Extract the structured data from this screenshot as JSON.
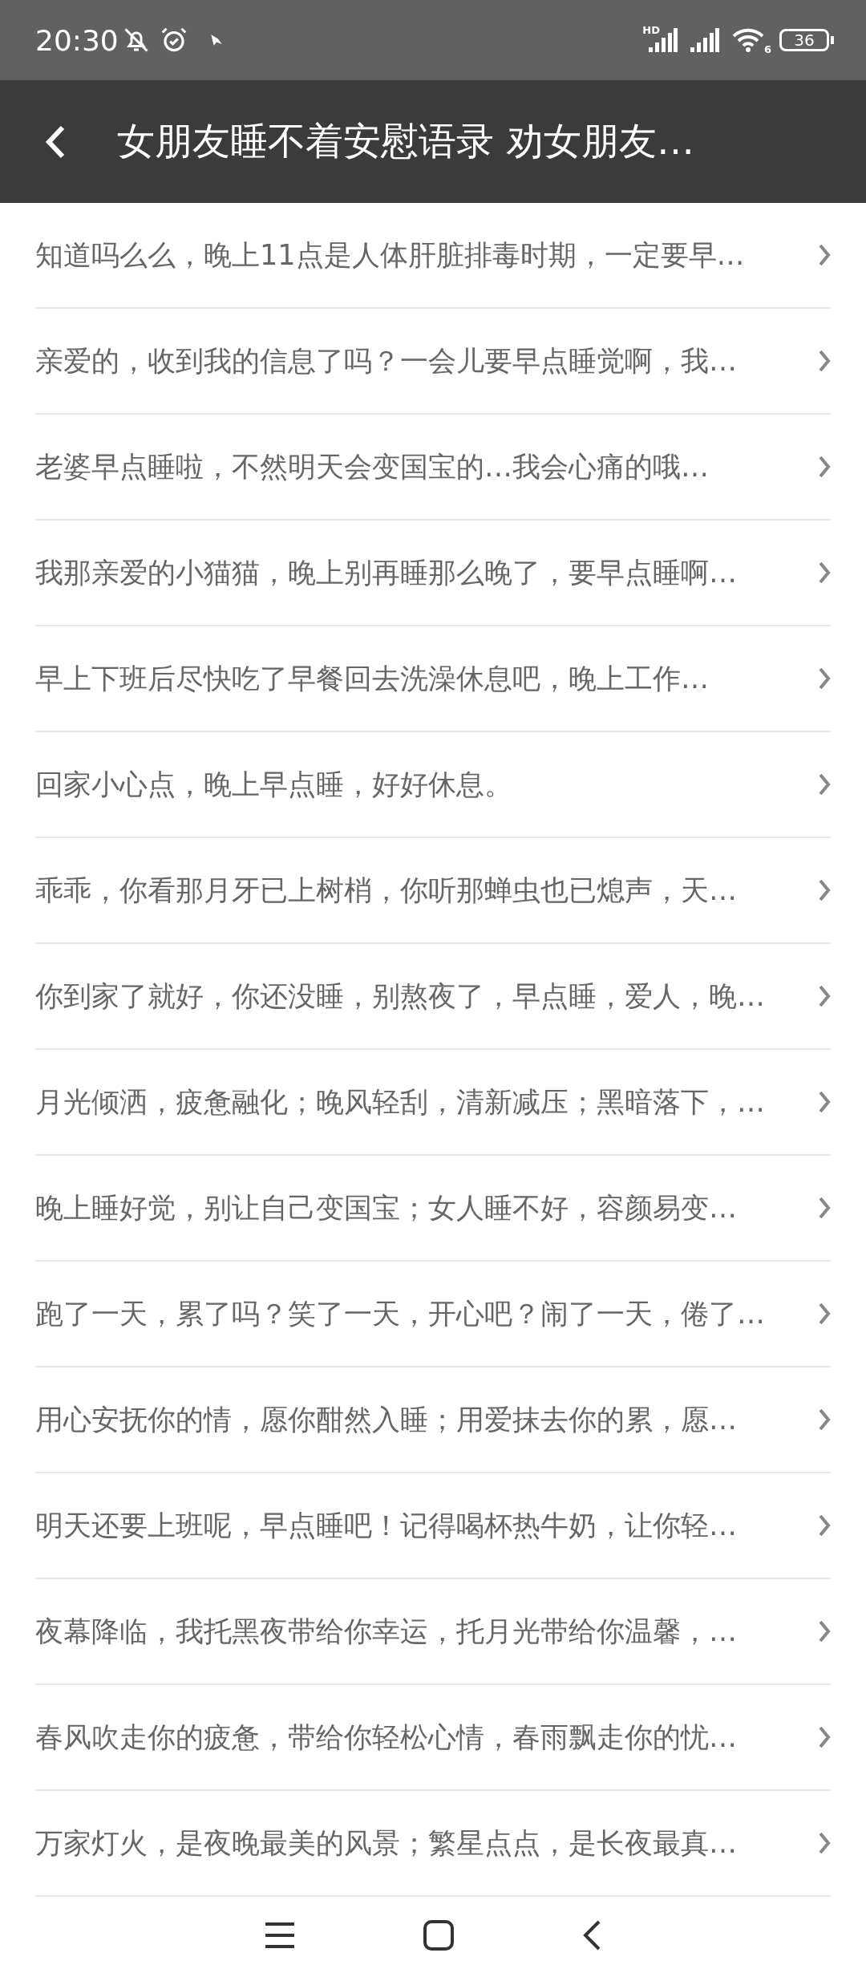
{
  "status_bar": {
    "time": "20:30",
    "network_label": "HD",
    "wifi_label": "6",
    "battery": "36"
  },
  "header": {
    "title": "女朋友睡不着安慰语录 劝女朋友…"
  },
  "items": [
    {
      "text": "知道吗么么，晚上11点是人体肝脏排毒时期，一定要早…"
    },
    {
      "text": "亲爱的，收到我的信息了吗？一会儿要早点睡觉啊，我…"
    },
    {
      "text": "老婆早点睡啦，不然明天会变国宝的…我会心痛的哦…"
    },
    {
      "text": "我那亲爱的小猫猫，晚上别再睡那么晚了，要早点睡啊…"
    },
    {
      "text": "早上下班后尽快吃了早餐回去洗澡休息吧，晚上工作…"
    },
    {
      "text": "回家小心点，晚上早点睡，好好休息。"
    },
    {
      "text": "乖乖，你看那月牙已上树梢，你听那蝉虫也已熄声，天…"
    },
    {
      "text": "你到家了就好，你还没睡，别熬夜了，早点睡，爱人，晚…"
    },
    {
      "text": "月光倾洒，疲惫融化；晚风轻刮，清新减压；黑暗落下，…"
    },
    {
      "text": "晚上睡好觉，别让自己变国宝；女人睡不好，容颜易变…"
    },
    {
      "text": "跑了一天，累了吗？笑了一天，开心吧？闹了一天，倦了…"
    },
    {
      "text": "用心安抚你的情，愿你酣然入睡；用爱抹去你的累，愿…"
    },
    {
      "text": "明天还要上班呢，早点睡吧！记得喝杯热牛奶，让你轻…"
    },
    {
      "text": "夜幕降临，我托黑夜带给你幸运，托月光带给你温馨，…"
    },
    {
      "text": "春风吹走你的疲惫，带给你轻松心情，春雨飘走你的忧…"
    },
    {
      "text": "万家灯火，是夜晚最美的风景；繁星点点，是长夜最真…"
    }
  ]
}
